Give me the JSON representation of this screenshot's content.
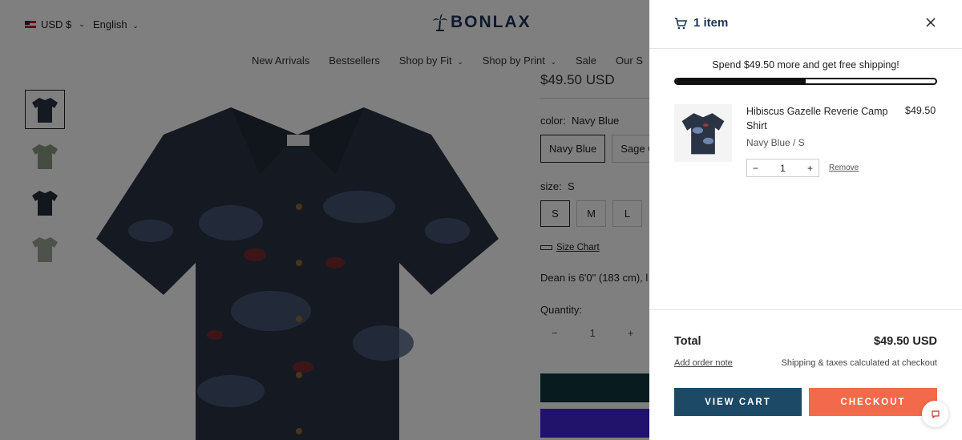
{
  "header": {
    "currency": "USD $",
    "language": "English",
    "brand": "BONLAX",
    "nav": [
      "New Arrivals",
      "Bestsellers",
      "Shop by Fit",
      "Shop by Print",
      "Sale",
      "Our S"
    ]
  },
  "product": {
    "price": "$49.50 USD",
    "color_label": "color:",
    "color_value": "Navy Blue",
    "colors": [
      "Navy Blue",
      "Sage G"
    ],
    "size_label": "size:",
    "size_value": "S",
    "sizes": [
      "S",
      "M",
      "L"
    ],
    "size_chart": "Size Chart",
    "model_note": "Dean is 6'0\" (183 cm), l",
    "quantity_label": "Quantity:",
    "quantity": "1",
    "minus": "−",
    "plus": "+"
  },
  "cart": {
    "count_label": "1 item",
    "shipping_message": "Spend $49.50 more and get free shipping!",
    "shipping_progress": 0.5,
    "item": {
      "title": "Hibiscus Gazelle Reverie Camp Shirt",
      "price": "$49.50",
      "variant": "Navy Blue / S",
      "quantity": "1",
      "minus": "−",
      "plus": "+",
      "remove": "Remove"
    },
    "total_label": "Total",
    "total_value": "$49.50 USD",
    "order_note": "Add order note",
    "shipping_note": "Shipping & taxes calculated at checkout",
    "view_cart": "VIEW CART",
    "checkout": "CHECKOUT"
  },
  "colors": {
    "brand": "#1d3557",
    "view_cart_bg": "#1c4966",
    "checkout_bg": "#f26a4b",
    "shirt": "#2b3445"
  }
}
